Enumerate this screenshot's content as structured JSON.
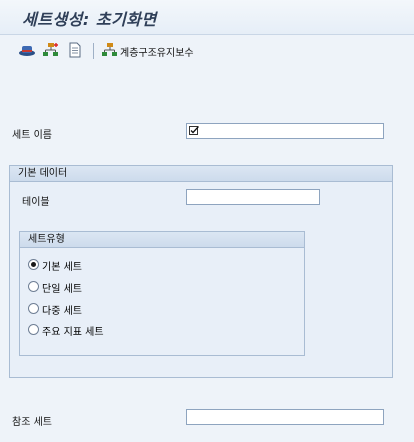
{
  "window": {
    "title": "세트생성: 초기화면"
  },
  "toolbar": {
    "buttons": [
      {
        "icon": "hat-icon"
      },
      {
        "icon": "hierarchy-add-icon"
      },
      {
        "icon": "document-icon"
      }
    ],
    "hierarchy_label": "계층구조유지보수"
  },
  "form": {
    "set_name_label": "세트 이름",
    "set_name_value": "",
    "basic_data": {
      "title": "기본 데이터",
      "table_label": "테이블",
      "table_value": "",
      "set_type": {
        "title": "세트유형",
        "options": [
          {
            "label": "기본 세트",
            "selected": true
          },
          {
            "label": "단일 세트",
            "selected": false
          },
          {
            "label": "다중 세트",
            "selected": false
          },
          {
            "label": "주요 지표 세트",
            "selected": false
          }
        ]
      }
    },
    "reference_set_label": "참조 세트",
    "reference_set_value": ""
  }
}
